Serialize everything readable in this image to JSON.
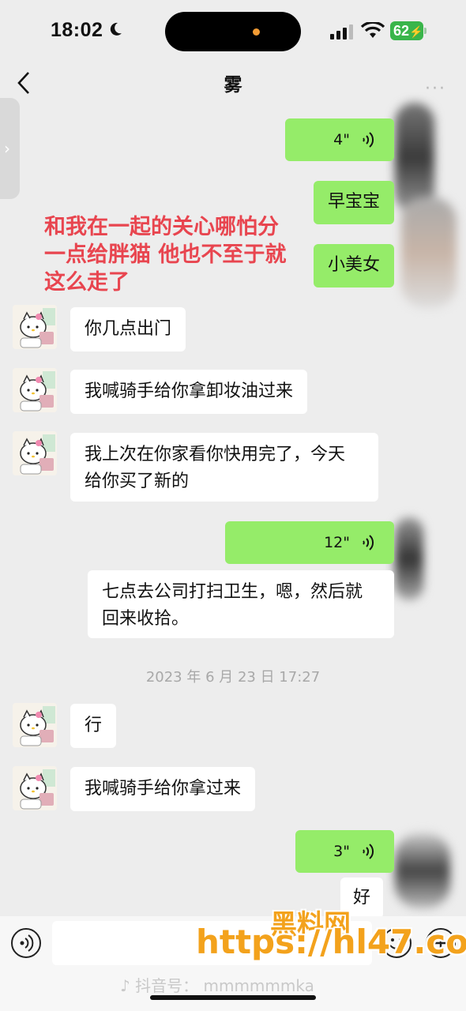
{
  "status_bar": {
    "time": "18:02",
    "battery": "62"
  },
  "header": {
    "title": "雾",
    "more": "···",
    "back_icon": "chevron-left-icon"
  },
  "messages": {
    "m1_duration": "4\"",
    "m2_text": "早宝宝",
    "m3_text": "小美女",
    "m4_text": "你几点出门",
    "m5_text": "我喊骑手给你拿卸妆油过来",
    "m6_line1": "我上次在你家看你快用完了，今天",
    "m6_line2": "给你买了新的",
    "m7_duration": "12\"",
    "m8_line1": "七点去公司打扫卫生，嗯，然后就",
    "m8_line2": "回来收拾。",
    "timestamp": "2023 年 6 月 23 日 17:27",
    "m9_text": "行",
    "m10_text": "我喊骑手给你拿过来",
    "m11_duration": "3\"",
    "m12_text": "好"
  },
  "overlay_caption": {
    "line1": "和我在一起的关心哪怕分",
    "line2": "一点给胖猫 他也不至于就",
    "line3": "这么走了"
  },
  "watermarks": {
    "site_name": "黑料网",
    "site_url": "https://hl47.co",
    "douyin": "抖音号：   mmmmmmka"
  },
  "colors": {
    "sent_bubble": "#95ec69",
    "received_bubble": "#ffffff",
    "background": "#ededed",
    "caption": "#e8454f",
    "watermark": "#f3a21c"
  }
}
